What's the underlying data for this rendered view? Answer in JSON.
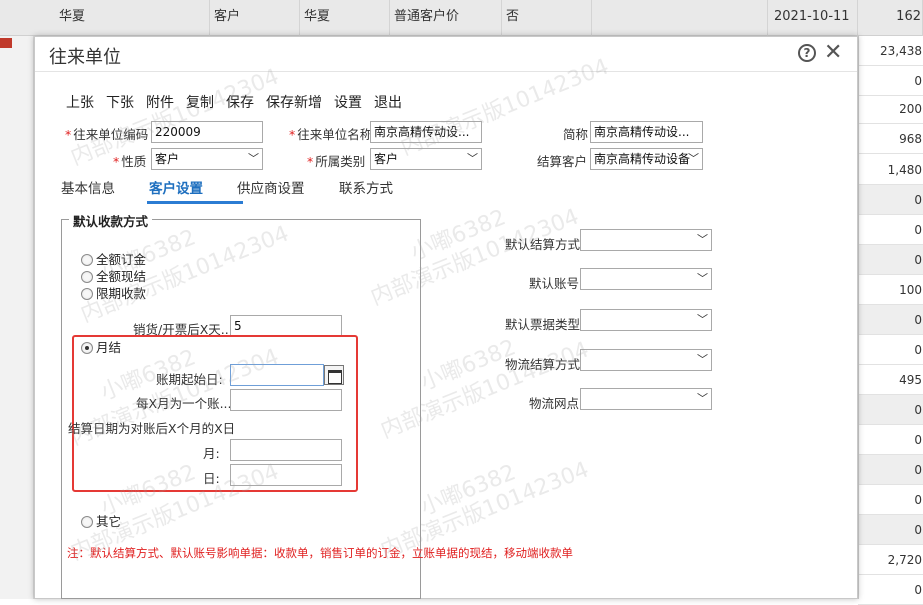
{
  "background": {
    "header_cells": [
      "华夏",
      "客户",
      "华夏",
      "普通客户价",
      "否",
      "",
      "2021-10-11",
      "162"
    ],
    "right_column_values": [
      "23,438",
      "0",
      "200",
      "968",
      "1,480",
      "0",
      "0",
      "0",
      "100",
      "0",
      "0",
      "495",
      "0",
      "0",
      "0",
      "0",
      "0",
      "2,720",
      "0"
    ]
  },
  "dialog": {
    "title": "往来单位",
    "help_icon": "question-circle-icon",
    "close_icon": "close-icon"
  },
  "toolbar": {
    "prev": "上张",
    "next": "下张",
    "attach": "附件",
    "copy": "复制",
    "save": "保存",
    "save_new": "保存新增",
    "settings": "设置",
    "exit": "退出"
  },
  "form": {
    "code_label": "往来单位编码",
    "code_value": "220009",
    "name_label": "往来单位名称",
    "name_value": "南京高精传动设...",
    "short_label": "简称",
    "short_value": "南京高精传动设...",
    "nature_label": "性质",
    "nature_value": "客户",
    "category_label": "所属类别",
    "category_value": "客户",
    "settle_customer_label": "结算客户",
    "settle_customer_value": "南京高精传动设备"
  },
  "tabs": {
    "basic": "基本信息",
    "customer": "客户设置",
    "supplier": "供应商设置",
    "contact": "联系方式"
  },
  "payment": {
    "legend": "默认收款方式",
    "opt_full_deposit": "全额订金",
    "opt_full_cash": "全额现结",
    "opt_term": "限期收款",
    "term_days_label": "销货/开票后X天...",
    "term_days_value": "5",
    "opt_monthly": "月结",
    "period_start_label": "账期起始日:",
    "period_start_value": "",
    "months_per_period_label": "每X月为一个账...",
    "months_per_period_value": "",
    "settle_date_caption": "结算日期为对账后X个月的X日",
    "month_label": "月:",
    "month_value": "",
    "day_label": "日:",
    "day_value": "",
    "opt_other": "其它",
    "selected": "opt_monthly"
  },
  "defaults": {
    "settle_method_label": "默认结算方式",
    "account_label": "默认账号",
    "invoice_type_label": "默认票据类型",
    "logistics_method_label": "物流结算方式",
    "logistics_point_label": "物流网点"
  },
  "note": "注：默认结算方式、默认账号影响单据：收款单，销售订单的订金，立账单据的现结，移动端收款单",
  "watermark": {
    "line1": "小嘟6382",
    "line2": "内部演示版10142304"
  },
  "colors": {
    "accent": "#2b7cd3",
    "required": "#e02020",
    "highlight_box": "#e53935"
  }
}
